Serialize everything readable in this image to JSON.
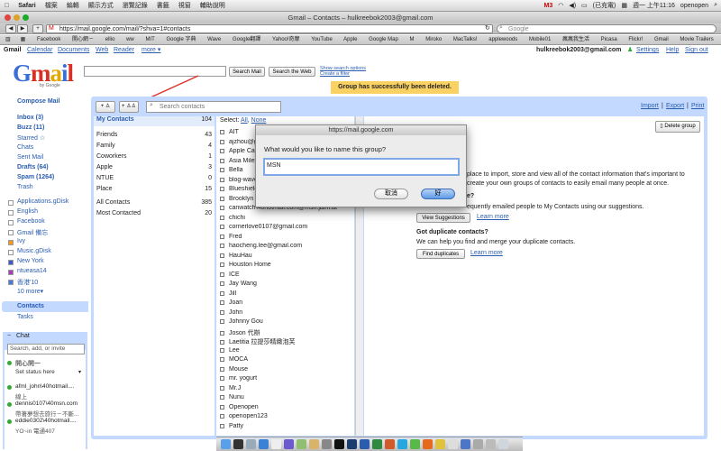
{
  "menubar": {
    "app": "Safari",
    "items": [
      "檔案",
      "編輯",
      "顯示方式",
      "瀏覽記錄",
      "書籤",
      "視窗",
      "輔助說明"
    ],
    "battery": "(已充電)",
    "clock": "週一 上午11:16",
    "user": "openopen",
    "mail_count": "3"
  },
  "window": {
    "title": "Gmail – Contacts – hulkreebok2003@gmail.com"
  },
  "toolbar": {
    "url": "https://mail.google.com/mail/?shva=1#contacts",
    "search_placeholder": "Google",
    "back": "◀",
    "forward": "▶",
    "add": "+"
  },
  "bookmarks": [
    "Facebook",
    "開心網－",
    "ellio",
    "ww",
    "MIT",
    "Google 字典",
    "Wave",
    "Google翻譯",
    "Yahoo!奇摩",
    "YouTube",
    "Apple",
    "Google Map",
    "M",
    "Miroko",
    "MacTalks!",
    "applewoods",
    "Mobile01",
    "瘋瘋我生活",
    "Picasa",
    "Flickr!",
    "Gmail",
    "Movie Trailers"
  ],
  "gmail_top": {
    "left": [
      "Gmail",
      "Calendar",
      "Documents",
      "Web",
      "Reader",
      "more ▾"
    ],
    "account": "hulkreebok2003@gmail.com",
    "right": [
      "Settings",
      "Help",
      "Sign out"
    ]
  },
  "search": {
    "mail_btn": "Search Mail",
    "web_btn": "Search the Web",
    "show_opts": "Show search options",
    "create_filter": "Create a filter"
  },
  "logo": {
    "g": "G",
    "m": "m",
    "a": "a",
    "i": "i",
    "l": "l",
    "sub": "by Google"
  },
  "banner": "Group has successfully been deleted.",
  "nav": {
    "compose": "Compose Mail",
    "items": [
      {
        "label": "Inbox (3)",
        "bold": true
      },
      {
        "label": "Buzz (11)",
        "bold": true
      },
      {
        "label": "Starred ☆",
        "bold": false
      },
      {
        "label": "Chats",
        "bold": false
      },
      {
        "label": "Sent Mail",
        "bold": false
      },
      {
        "label": "Drafts (64)",
        "bold": true
      },
      {
        "label": "Spam (1264)",
        "bold": true
      },
      {
        "label": "Trash",
        "bold": false
      }
    ],
    "labels": [
      {
        "label": "Applications.gDisk",
        "color": "#ffffff"
      },
      {
        "label": "English",
        "color": "#ffffff"
      },
      {
        "label": "Facebook",
        "color": "#ffffff"
      },
      {
        "label": "Gmail 備忘",
        "color": "#ffffff"
      },
      {
        "label": "Ivy",
        "color": "#f29b22"
      },
      {
        "label": "Music.gDisk",
        "color": "#ffffff"
      },
      {
        "label": "New York",
        "color": "#3d5ac9"
      },
      {
        "label": "ntueasa14",
        "color": "#a440b5"
      },
      {
        "label": "香港'10",
        "color": "#4a7dd6"
      }
    ],
    "more": "10 more▾",
    "contacts": "Contacts",
    "tasks": "Tasks"
  },
  "chat": {
    "title": "Chat",
    "search_placeholder": "Search, add, or invite",
    "me": "開心開一",
    "status": "Set status here",
    "buddies": [
      {
        "name": "afml_john\\40hotmail....",
        "status": "線上"
      },
      {
        "name": "dennis0107\\40msn.com",
        "status": "帶著夢想去旅行－不斷..."
      },
      {
        "name": "eddie0302\\40hotmail....",
        "status": "YO~in 電通407"
      }
    ]
  },
  "contacts_toolbar": {
    "search_placeholder": "Search contacts",
    "import": "Import",
    "export": "Export",
    "print": "Print",
    "delete_group": "Delete group"
  },
  "groups": [
    {
      "name": "My Contacts",
      "count": "104"
    },
    {
      "name": "Friends",
      "count": "43"
    },
    {
      "name": "Family",
      "count": "4"
    },
    {
      "name": "Coworkers",
      "count": "1"
    },
    {
      "name": "Apple",
      "count": "3"
    },
    {
      "name": "NTUE",
      "count": "0"
    },
    {
      "name": "Place",
      "count": "15"
    },
    {
      "name": "All Contacts",
      "count": "385"
    },
    {
      "name": "Most Contacted",
      "count": "20"
    }
  ],
  "select": {
    "label": "Select:",
    "all": "All",
    "none": "None"
  },
  "contacts": [
    "AIT",
    "ajzhou@gmail.com",
    "Apple Care",
    "Asia Miles",
    "Bella",
    "blog-wave",
    "Blueshield",
    "Brooklyn",
    "canwatch\\40hotmail.com@msn.jaim.at",
    "chichi",
    "cornerlove0107@gmail.com",
    "Fred",
    "haocheng.lee@gmail.com",
    "HauHau",
    "Houston Home",
    "ICE",
    "Jay Wang",
    "Jill",
    "Joan",
    "John",
    "Johnny Gou",
    "Joson 代辦",
    "Laetitia 拉提莎精緻泡芙",
    "Lee",
    "MOCA",
    "Mouse",
    "mr. yogurt",
    "Mr.J",
    "Nunu",
    "Openopen",
    "openopen123",
    "Patty"
  ],
  "detail": {
    "line1": "place to import, store and view all of the contact information that's important to",
    "line2": "create your own groups of contacts to easily email many people at once.",
    "q1": "e?",
    "line3": "equently emailed people to My Contacts using our suggestions.",
    "view_suggestions": "View Suggestions",
    "learn_more": "Learn more",
    "dup_title": "Got duplicate contacts?",
    "dup_text": "We can help you find and merge your duplicate contacts.",
    "find_dup": "Find duplicates"
  },
  "dialog": {
    "title": "https://mail.google.com",
    "prompt": "What would you like to name this group?",
    "value": "MSN",
    "cancel": "取消",
    "ok": "好"
  }
}
